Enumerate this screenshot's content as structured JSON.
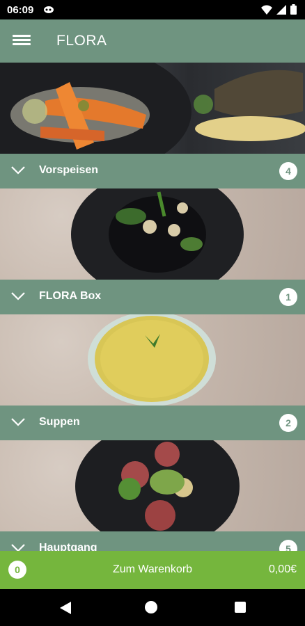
{
  "status": {
    "time": "06:09"
  },
  "app": {
    "title": "FLORA"
  },
  "categories": [
    {
      "label": "Vorspeisen",
      "count": "4"
    },
    {
      "label": "FLORA Box",
      "count": "1"
    },
    {
      "label": "Suppen",
      "count": "2"
    },
    {
      "label": "Hauptgang",
      "count": "5"
    }
  ],
  "cart": {
    "count": "0",
    "label": "Zum Warenkorb",
    "total": "0,00€"
  },
  "colors": {
    "header": "#6f9480",
    "cart": "#75b63d",
    "status": "#000000"
  }
}
